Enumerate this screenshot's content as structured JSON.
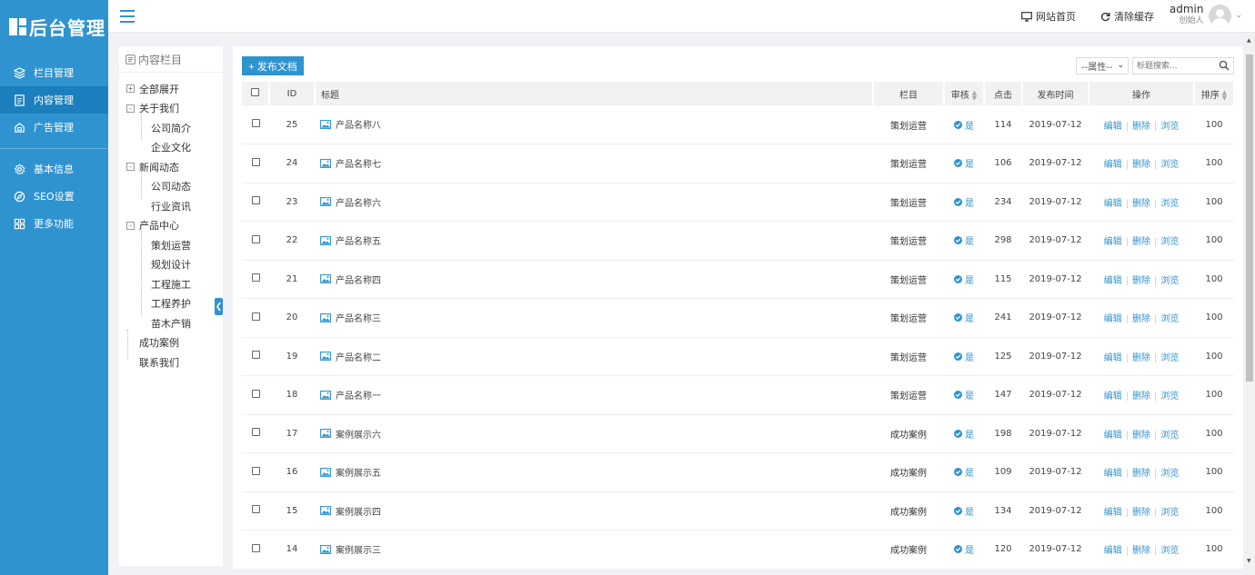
{
  "app": {
    "logo_text": "后台管理"
  },
  "sidebar": {
    "items": [
      {
        "label": "栏目管理",
        "icon": "layers-icon",
        "active": false
      },
      {
        "label": "内容管理",
        "icon": "document-icon",
        "active": true
      },
      {
        "label": "广告管理",
        "icon": "ad-icon",
        "active": false
      },
      {
        "label": "基本信息",
        "icon": "gear-icon",
        "active": false
      },
      {
        "label": "SEO设置",
        "icon": "compass-icon",
        "active": false
      },
      {
        "label": "更多功能",
        "icon": "grid-icon",
        "active": false
      }
    ]
  },
  "header": {
    "home_label": "网站首页",
    "clear_cache_label": "清除缓存",
    "user_name": "admin",
    "user_role": "创始人"
  },
  "tree": {
    "title": "内容栏目",
    "nodes": [
      {
        "label": "全部展开",
        "level": 0,
        "toggle": "+"
      },
      {
        "label": "关于我们",
        "level": 0,
        "toggle": "-"
      },
      {
        "label": "公司简介",
        "level": 1
      },
      {
        "label": "企业文化",
        "level": 1
      },
      {
        "label": "新闻动态",
        "level": 0,
        "toggle": "-"
      },
      {
        "label": "公司动态",
        "level": 1
      },
      {
        "label": "行业资讯",
        "level": 1
      },
      {
        "label": "产品中心",
        "level": 0,
        "toggle": "-"
      },
      {
        "label": "策划运营",
        "level": 1
      },
      {
        "label": "规划设计",
        "level": 1
      },
      {
        "label": "工程施工",
        "level": 1
      },
      {
        "label": "工程养护",
        "level": 1
      },
      {
        "label": "苗木产销",
        "level": 1
      },
      {
        "label": "成功案例",
        "level": 0
      },
      {
        "label": "联系我们",
        "level": 0
      }
    ]
  },
  "toolbar": {
    "add_label": "+ 发布文档",
    "attr_select_value": "--属性--",
    "search_placeholder": "标题搜索..."
  },
  "table": {
    "headers": {
      "id": "ID",
      "title": "标题",
      "column": "栏目",
      "audit": "审核",
      "clicks": "点击",
      "date": "发布时间",
      "ops": "操作",
      "order": "排序"
    },
    "op_edit": "编辑",
    "op_delete": "删除",
    "op_view": "浏览",
    "audit_yes": "是",
    "rows": [
      {
        "id": "25",
        "title": "产品名称八",
        "column": "策划运营",
        "clicks": "114",
        "date": "2019-07-12",
        "order": "100"
      },
      {
        "id": "24",
        "title": "产品名称七",
        "column": "策划运营",
        "clicks": "106",
        "date": "2019-07-12",
        "order": "100"
      },
      {
        "id": "23",
        "title": "产品名称六",
        "column": "策划运营",
        "clicks": "234",
        "date": "2019-07-12",
        "order": "100"
      },
      {
        "id": "22",
        "title": "产品名称五",
        "column": "策划运营",
        "clicks": "298",
        "date": "2019-07-12",
        "order": "100"
      },
      {
        "id": "21",
        "title": "产品名称四",
        "column": "策划运营",
        "clicks": "115",
        "date": "2019-07-12",
        "order": "100"
      },
      {
        "id": "20",
        "title": "产品名称三",
        "column": "策划运营",
        "clicks": "241",
        "date": "2019-07-12",
        "order": "100"
      },
      {
        "id": "19",
        "title": "产品名称二",
        "column": "策划运营",
        "clicks": "125",
        "date": "2019-07-12",
        "order": "100"
      },
      {
        "id": "18",
        "title": "产品名称一",
        "column": "策划运营",
        "clicks": "147",
        "date": "2019-07-12",
        "order": "100"
      },
      {
        "id": "17",
        "title": "案例展示六",
        "column": "成功案例",
        "clicks": "198",
        "date": "2019-07-12",
        "order": "100"
      },
      {
        "id": "16",
        "title": "案例展示五",
        "column": "成功案例",
        "clicks": "109",
        "date": "2019-07-12",
        "order": "100"
      },
      {
        "id": "15",
        "title": "案例展示四",
        "column": "成功案例",
        "clicks": "134",
        "date": "2019-07-12",
        "order": "100"
      },
      {
        "id": "14",
        "title": "案例展示三",
        "column": "成功案例",
        "clicks": "120",
        "date": "2019-07-12",
        "order": "100"
      }
    ]
  },
  "colors": {
    "primary": "#2f93d0",
    "sidebar_active": "#1c7fbd"
  }
}
